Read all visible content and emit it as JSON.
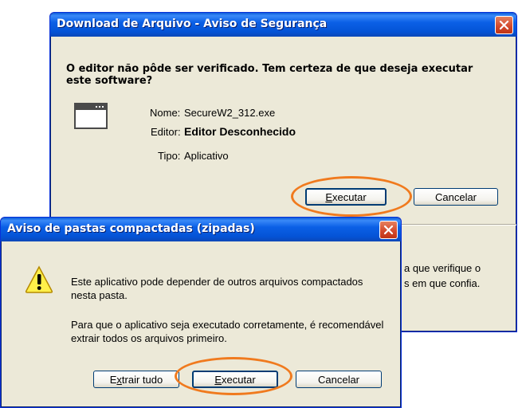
{
  "dialog1": {
    "title": "Download de Arquivo - Aviso de Segurança",
    "question": "O editor não pôde ser verificado.  Tem certeza de que deseja executar este software?",
    "name_label": "Nome:",
    "name_value": "SecureW2_312.exe",
    "publisher_label": "Editor:",
    "publisher_value": "Editor Desconhecido",
    "type_label": "Tipo:",
    "type_value": "Aplicativo",
    "run_button_first": "E",
    "run_button_rest": "xecutar",
    "cancel_button": "Cancelar",
    "partial_line1": "a que verifique o",
    "partial_line2": "s em que confia."
  },
  "dialog2": {
    "title": "Aviso de pastas compactadas (zipadas)",
    "message1": "Este aplicativo pode depender de outros arquivos compactados nesta pasta.",
    "message2": "Para que o aplicativo seja executado corretamente, é recomendável extrair todos os arquivos primeiro.",
    "extract_first": "E",
    "extract_u": "x",
    "extract_rest": "trair tudo",
    "run_first": "E",
    "run_rest": "xecutar",
    "cancel_button": "Cancelar"
  },
  "icons": {
    "app": "application-window-icon",
    "warning": "warning-icon",
    "close": "close-icon"
  },
  "colors": {
    "titlebar": "#0a5ad8",
    "dialog_bg": "#ece9d8",
    "close": "#d2472a",
    "highlight": "#f07a1e"
  }
}
